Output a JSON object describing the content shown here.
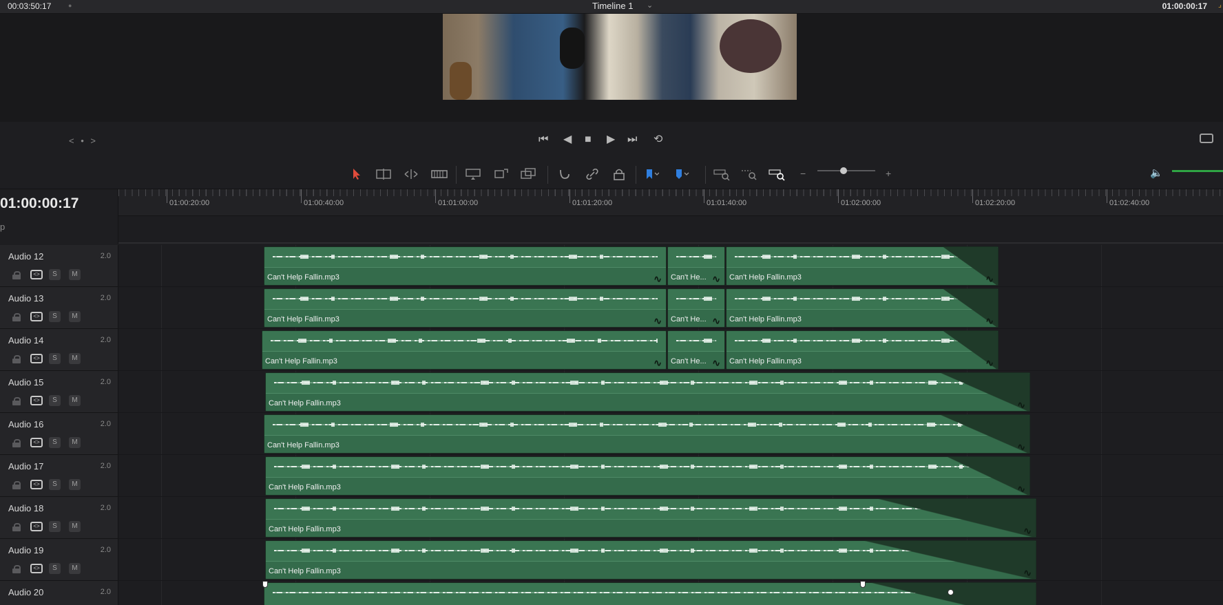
{
  "topbar": {
    "source_timecode": "00:03:50:17",
    "timeline_name": "Timeline 1",
    "record_timecode": "01:00:00:17"
  },
  "transport": {
    "nav_label": "< • >",
    "first_frame_icon": "skip-to-start-icon",
    "reverse_icon": "play-reverse-icon",
    "stop_icon": "stop-icon",
    "play_icon": "play-icon",
    "last_frame_icon": "skip-to-end-icon",
    "loop_icon": "loop-icon"
  },
  "toolbar": {
    "tools": [
      "selection-arrow-icon",
      "trim-edit-icon",
      "dynamic-trim-icon",
      "blade-icon",
      "overwrite-clip-icon",
      "replace-clip-icon",
      "place-on-top-icon",
      "snapping-icon",
      "linked-selection-icon",
      "position-lock-icon",
      "flag-icon",
      "marker-icon",
      "zoom-full-icon",
      "zoom-detail-icon",
      "zoom-custom-icon"
    ],
    "zoom_minus": "−",
    "zoom_plus": "+",
    "zoom_level": 0.45,
    "volume_icon": "speaker-icon",
    "accent_color": "#e14b3b",
    "flag_color": "#2f7fe0"
  },
  "timeline": {
    "timecode": "01:00:00:17",
    "sub_label": "p",
    "ruler_labels": [
      "01:00:20:00",
      "01:00:40:00",
      "01:01:00:00",
      "01:01:20:00",
      "01:01:40:00",
      "01:02:00:00",
      "01:02:20:00",
      "01:02:40:00"
    ]
  },
  "tracks": [
    {
      "name": "Audio 12",
      "channels": "2.0",
      "solo": "S",
      "mute": "M",
      "clips": [
        "Can't Help Fallin.mp3",
        "Can't He...",
        "Can't Help Fallin.mp3"
      ]
    },
    {
      "name": "Audio 13",
      "channels": "2.0",
      "solo": "S",
      "mute": "M",
      "clips": [
        "Can't Help Fallin.mp3",
        "Can't He...",
        "Can't Help Fallin.mp3"
      ]
    },
    {
      "name": "Audio 14",
      "channels": "2.0",
      "solo": "S",
      "mute": "M",
      "clips": [
        "Can't Help Fallin.mp3",
        "Can't He...",
        "Can't Help Fallin.mp3"
      ]
    },
    {
      "name": "Audio 15",
      "channels": "2.0",
      "solo": "S",
      "mute": "M",
      "clips": [
        "Can't Help Fallin.mp3"
      ]
    },
    {
      "name": "Audio 16",
      "channels": "2.0",
      "solo": "S",
      "mute": "M",
      "clips": [
        "Can't Help Fallin.mp3"
      ]
    },
    {
      "name": "Audio 17",
      "channels": "2.0",
      "solo": "S",
      "mute": "M",
      "clips": [
        "Can't Help Fallin.mp3"
      ]
    },
    {
      "name": "Audio 18",
      "channels": "2.0",
      "solo": "S",
      "mute": "M",
      "clips": [
        "Can't Help Fallin.mp3"
      ]
    },
    {
      "name": "Audio 19",
      "channels": "2.0",
      "solo": "S",
      "mute": "M",
      "clips": [
        "Can't Help Fallin.mp3"
      ]
    },
    {
      "name": "Audio 20",
      "channels": "2.0",
      "solo": "S",
      "mute": "M",
      "clips": []
    }
  ]
}
